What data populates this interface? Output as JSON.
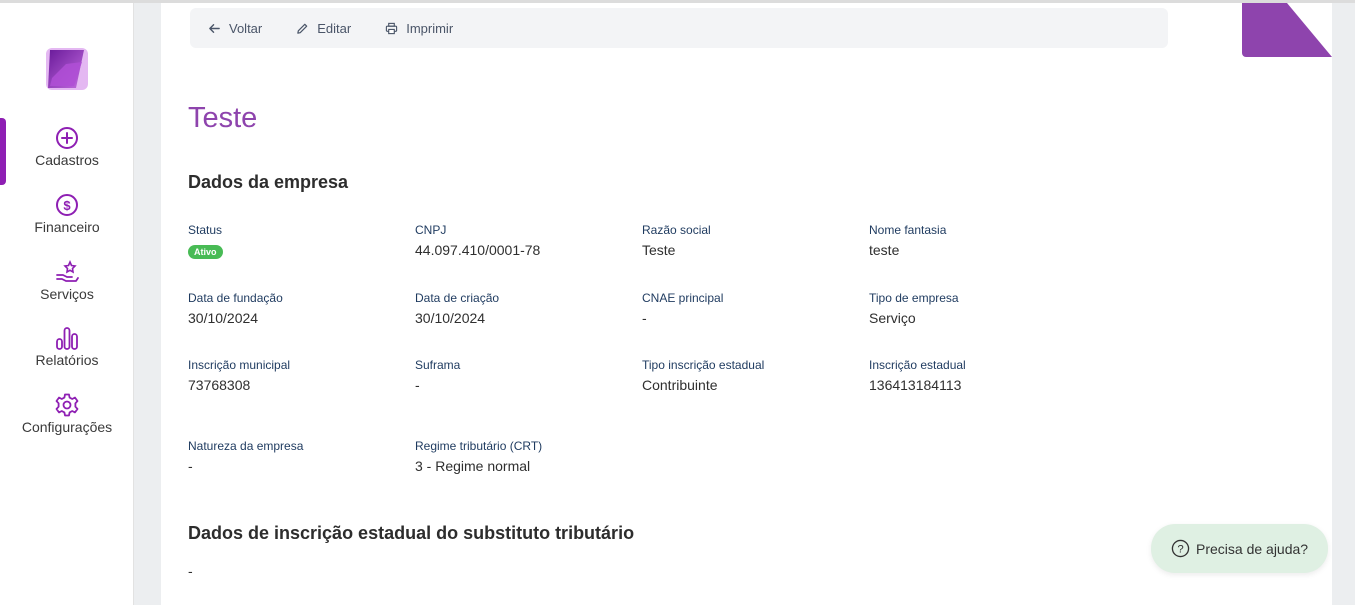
{
  "sidebar": {
    "items": [
      {
        "label": "Cadastros",
        "icon": "plus-circle-icon"
      },
      {
        "label": "Financeiro",
        "icon": "dollar-circle-icon"
      },
      {
        "label": "Serviços",
        "icon": "hand-star-icon"
      },
      {
        "label": "Relatórios",
        "icon": "bar-chart-icon"
      },
      {
        "label": "Configurações",
        "icon": "gear-icon"
      }
    ],
    "active_index": 0
  },
  "toolbar": {
    "back_label": "Voltar",
    "edit_label": "Editar",
    "print_label": "Imprimir"
  },
  "page": {
    "title": "Teste",
    "section_company": "Dados da empresa",
    "section_substitute": "Dados de inscrição estadual do substituto tributário",
    "substitute_value": "-"
  },
  "fields": {
    "status": {
      "label": "Status",
      "value": "Ativo"
    },
    "cnpj": {
      "label": "CNPJ",
      "value": "44.097.410/0001-78"
    },
    "razao_social": {
      "label": "Razão social",
      "value": "Teste"
    },
    "nome_fantasia": {
      "label": "Nome fantasia",
      "value": "teste"
    },
    "data_fundacao": {
      "label": "Data de fundação",
      "value": "30/10/2024"
    },
    "data_criacao": {
      "label": "Data de criação",
      "value": "30/10/2024"
    },
    "cnae": {
      "label": "CNAE principal",
      "value": "-"
    },
    "tipo_empresa": {
      "label": "Tipo de empresa",
      "value": "Serviço"
    },
    "insc_municipal": {
      "label": "Inscrição municipal",
      "value": "73768308"
    },
    "suframa": {
      "label": "Suframa",
      "value": "-"
    },
    "tipo_insc_estadual": {
      "label": "Tipo inscrição estadual",
      "value": "Contribuinte"
    },
    "insc_estadual": {
      "label": "Inscrição estadual",
      "value": "136413184113"
    },
    "natureza": {
      "label": "Natureza da empresa",
      "value": "-"
    },
    "regime": {
      "label": "Regime tributário (CRT)",
      "value": "3 - Regime normal"
    }
  },
  "help": {
    "label": "Precisa de ajuda?"
  },
  "colors": {
    "accent": "#8e44ad",
    "status_active": "#48bb55",
    "help_bg": "#dff0e3"
  }
}
